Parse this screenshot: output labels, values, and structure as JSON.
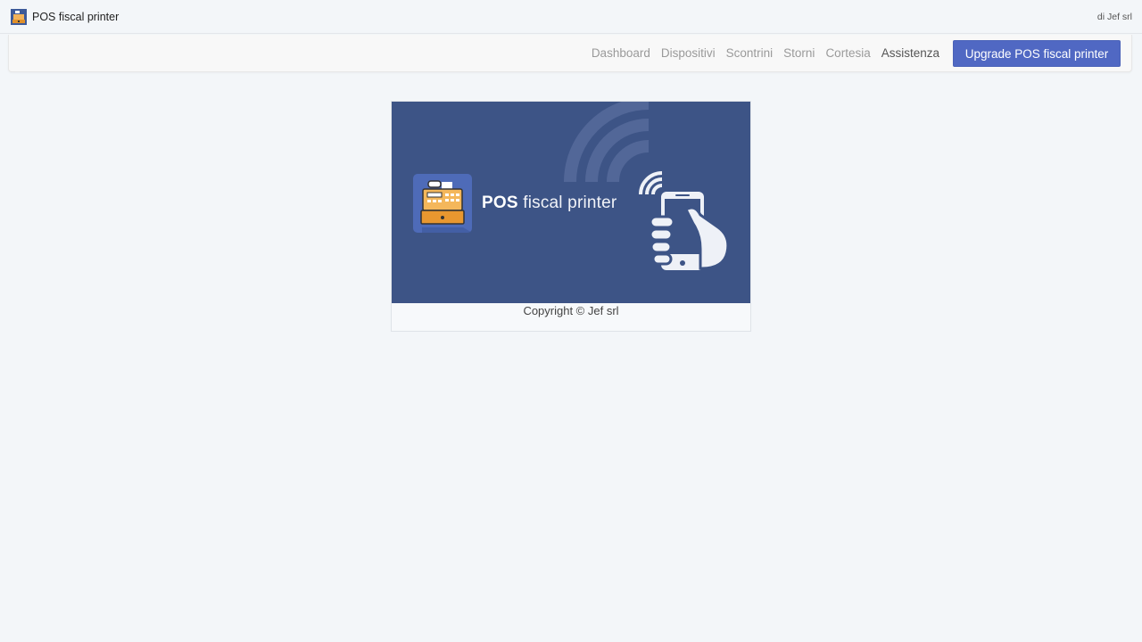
{
  "titlebar": {
    "app_title": "POS fiscal printer",
    "vendor": "di Jef srl",
    "icon": "cash-register-icon"
  },
  "nav": {
    "links": [
      {
        "label": "Dashboard",
        "active": false
      },
      {
        "label": "Dispositivi",
        "active": false
      },
      {
        "label": "Scontrini",
        "active": false
      },
      {
        "label": "Storni",
        "active": false
      },
      {
        "label": "Cortesia",
        "active": false
      },
      {
        "label": "Assistenza",
        "active": true
      }
    ],
    "upgrade_label": "Upgrade POS fiscal printer"
  },
  "banner": {
    "title_bold": "POS",
    "title_light": "fiscal printer",
    "background": "#3d5486",
    "icons": [
      "cash-register-icon",
      "wifi-waves-icon",
      "hand-phone-icon"
    ]
  },
  "footer": {
    "copyright": "Copyright © Jef srl"
  },
  "colors": {
    "accent": "#5068c3",
    "page_bg": "#f3f6f9"
  }
}
